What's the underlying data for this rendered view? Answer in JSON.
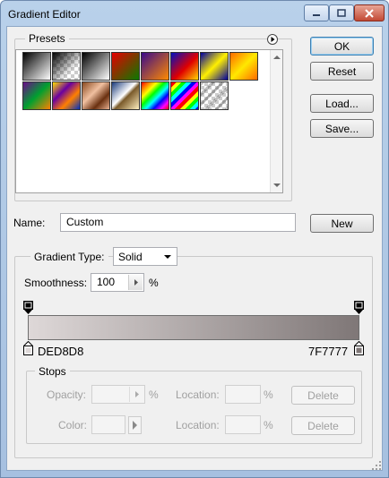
{
  "window": {
    "title": "Gradient Editor"
  },
  "presets": {
    "label": "Presets",
    "swatches": [
      {
        "name": "preset-foreground-to-background",
        "bg": "linear-gradient(135deg,#000 0%,#fff 100%)"
      },
      {
        "name": "preset-foreground-to-transparent",
        "bg": "linear-gradient(135deg,#000 0%,rgba(0,0,0,0) 70%),repeating-conic-gradient(#ccc 0 25%,#fff 0 50%) 0 0/8px 8px"
      },
      {
        "name": "preset-black-white",
        "bg": "linear-gradient(135deg,#000 0%,#fff 100%)"
      },
      {
        "name": "preset-red-green",
        "bg": "linear-gradient(135deg,#e60000 0%,#0a7a00 100%)"
      },
      {
        "name": "preset-violet-orange",
        "bg": "linear-gradient(135deg,#3a0a8a 0%,#ff8a00 100%)"
      },
      {
        "name": "preset-blue-red-yellow",
        "bg": "linear-gradient(135deg,#0010c0 0%,#e00000 55%,#ffd800 100%)"
      },
      {
        "name": "preset-blue-yellow-blue",
        "bg": "linear-gradient(135deg,#0000a0 0%,#fff000 50%,#0000a0 100%)"
      },
      {
        "name": "preset-orange-yellow-orange",
        "bg": "linear-gradient(135deg,#ff6a00 0%,#ffe800 50%,#ff6a00 100%)"
      },
      {
        "name": "preset-violet-green-orange",
        "bg": "linear-gradient(135deg,#6a0a8a 0%,#00a030 50%,#ff8000 100%)"
      },
      {
        "name": "preset-yellow-violet-orange-blue",
        "bg": "linear-gradient(135deg,#ffe000 0%,#6a00a0 35%,#ff8000 65%,#0030c0 100%)"
      },
      {
        "name": "preset-copper",
        "bg": "linear-gradient(135deg,#8a4a20 0%,#f0c0a0 40%,#6a3010 70%,#e8b090 100%)"
      },
      {
        "name": "preset-chrome",
        "bg": "linear-gradient(135deg,#1a3a7a 0%,#ffffff 45%,#7a5a2a 55%,#fff0c0 100%)"
      },
      {
        "name": "preset-spectrum",
        "bg": "linear-gradient(135deg,#ff0000,#ff8000,#ffff00,#00ff00,#00ffff,#0000ff,#ff00ff,#ff0000)"
      },
      {
        "name": "preset-transparent-rainbow",
        "bg": "repeating-linear-gradient(135deg,#ff0000 0 4px,#ffff00 4px 8px,#00ff00 8px 12px,#00ffff 12px 16px,#0000ff 16px 20px,#ff00ff 20px 24px)"
      },
      {
        "name": "preset-transparent-stripes",
        "bg": "repeating-linear-gradient(135deg,rgba(0,0,0,0.25) 0 3px,rgba(255,255,255,0) 3px 8px),repeating-conic-gradient(#ccc 0 25%,#fff 0 50%) 0 0/8px 8px"
      }
    ]
  },
  "buttons": {
    "ok": "OK",
    "reset": "Reset",
    "load": "Load...",
    "save": "Save...",
    "new": "New"
  },
  "name_field": {
    "label": "Name:",
    "value": "Custom"
  },
  "gradient_type": {
    "label": "Gradient Type:",
    "selected": "Solid",
    "smoothness_label": "Smoothness:",
    "smoothness_value": "100",
    "smoothness_unit": "%"
  },
  "gradient": {
    "left_color": "#DED8D8",
    "right_color": "#7F7777",
    "left_label": "DED8D8",
    "right_label": "7F7777"
  },
  "stops": {
    "label": "Stops",
    "opacity_label": "Opacity:",
    "opacity_unit": "%",
    "location_label": "Location:",
    "location_unit": "%",
    "delete_label": "Delete",
    "color_label": "Color:"
  }
}
